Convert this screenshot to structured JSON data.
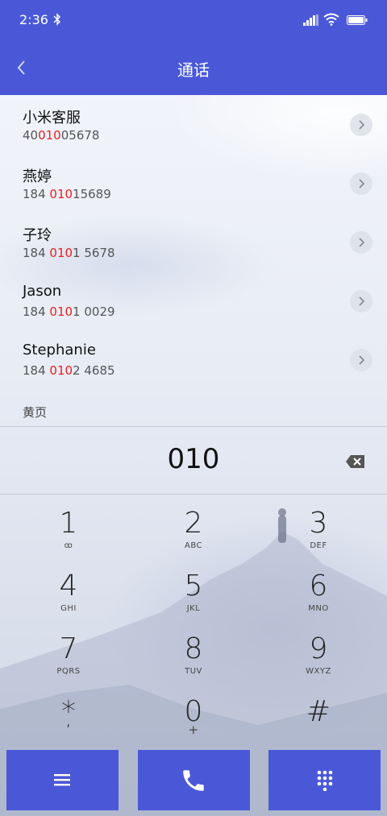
{
  "status_bar": {
    "time": "2:36"
  },
  "header": {
    "title": "通话"
  },
  "contacts": [
    {
      "name": "小米客服",
      "num_pre": "40",
      "num_hl": "010",
      "num_post": "05678"
    },
    {
      "name": "燕婷",
      "num_pre": "184 ",
      "num_hl": "010",
      "num_post": "15689"
    },
    {
      "name": "子玲",
      "num_pre": "184 ",
      "num_hl": "010",
      "num_post": "1 5678"
    },
    {
      "name": "Jason",
      "num_pre": "184 ",
      "num_hl": "010",
      "num_post": "1 0029"
    },
    {
      "name": "Stephanie",
      "num_pre": "184 ",
      "num_hl": "010",
      "num_post": "2 4685"
    }
  ],
  "section_label": "黄页",
  "dialer": {
    "input": "010"
  },
  "keypad": [
    {
      "digit": "1",
      "letters": "ꝏ"
    },
    {
      "digit": "2",
      "letters": "ABC"
    },
    {
      "digit": "3",
      "letters": "DEF"
    },
    {
      "digit": "4",
      "letters": "GHI"
    },
    {
      "digit": "5",
      "letters": "JKL"
    },
    {
      "digit": "6",
      "letters": "MNO"
    },
    {
      "digit": "7",
      "letters": "PQRS"
    },
    {
      "digit": "8",
      "letters": "TUV"
    },
    {
      "digit": "9",
      "letters": "WXYZ"
    },
    {
      "digit": "*",
      "letters": ","
    },
    {
      "digit": "0",
      "letters": "+"
    },
    {
      "digit": "#",
      "letters": ""
    }
  ],
  "icons": {
    "back": "chevron-left-icon",
    "menu": "menu-icon",
    "call": "phone-icon",
    "dialpad": "dialpad-icon",
    "backspace": "backspace-icon"
  },
  "colors": {
    "accent": "#4a58d8",
    "highlight": "#e8201f"
  }
}
